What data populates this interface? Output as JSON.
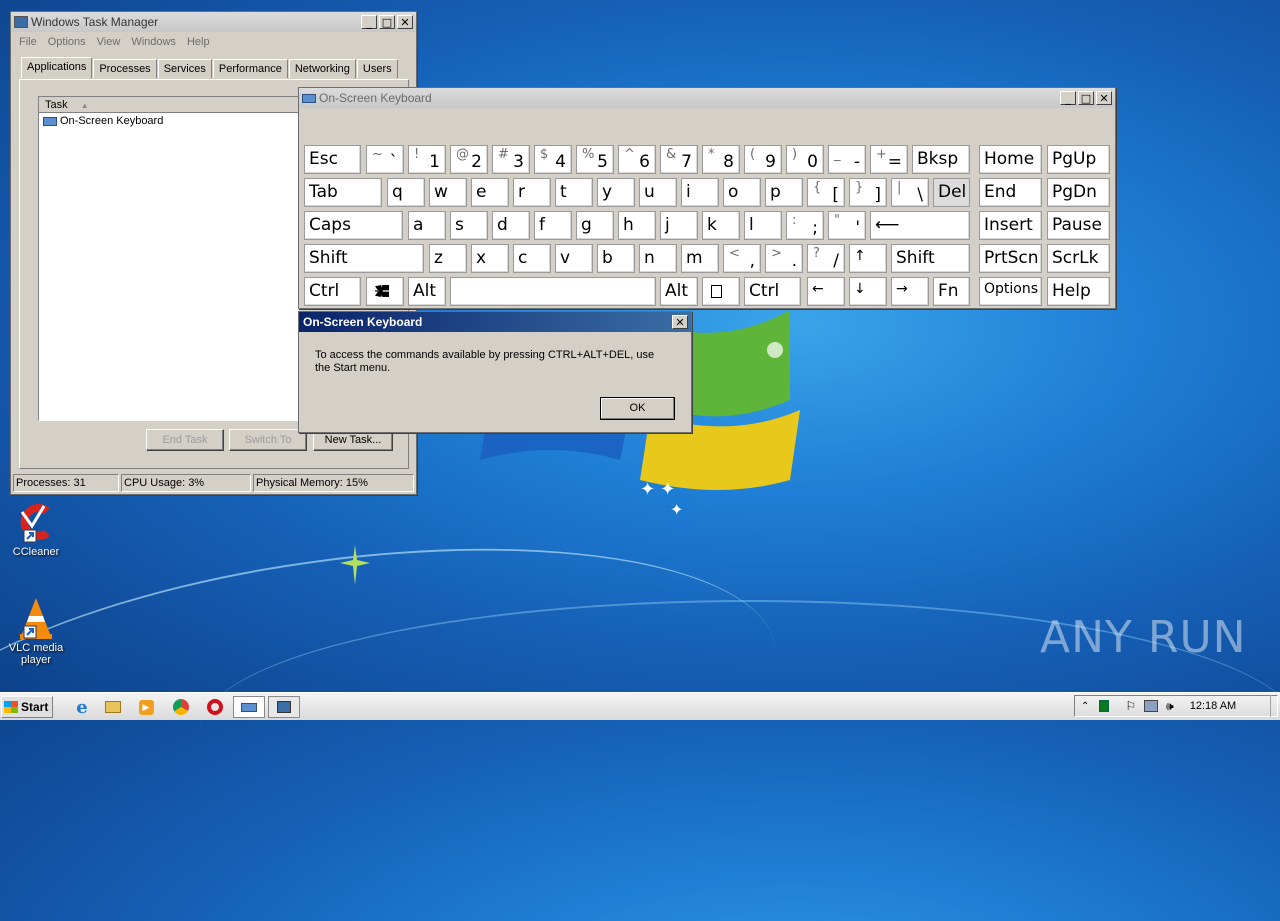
{
  "taskmgr": {
    "title": "Windows Task Manager",
    "menu": [
      "File",
      "Options",
      "View",
      "Windows",
      "Help"
    ],
    "tabs": [
      "Applications",
      "Processes",
      "Services",
      "Performance",
      "Networking",
      "Users"
    ],
    "list_header": "Task",
    "tasks": [
      "On-Screen Keyboard"
    ],
    "buttons": {
      "end_task": "End Task",
      "switch_to": "Switch To",
      "new_task": "New Task..."
    },
    "status": {
      "processes": "Processes: 31",
      "cpu": "CPU Usage: 3%",
      "memory": "Physical Memory: 15%"
    }
  },
  "osk": {
    "title": "On-Screen Keyboard",
    "keys": {
      "esc": "Esc",
      "bksp": "Bksp",
      "tab": "Tab",
      "del": "Del",
      "caps": "Caps",
      "shift": "Shift",
      "ctrl": "Ctrl",
      "alt": "Alt",
      "home": "Home",
      "pgup": "PgUp",
      "end": "End",
      "pgdn": "PgDn",
      "insert": "Insert",
      "pause": "Pause",
      "prtscn": "PrtScn",
      "scrlk": "ScrLk",
      "fn": "Fn",
      "options": "Options",
      "help": "Help"
    },
    "row1": [
      [
        "~",
        "`"
      ],
      [
        "!",
        "1"
      ],
      [
        "@",
        "2"
      ],
      [
        "#",
        "3"
      ],
      [
        "$",
        "4"
      ],
      [
        "%",
        "5"
      ],
      [
        "^",
        "6"
      ],
      [
        "&",
        "7"
      ],
      [
        "*",
        "8"
      ],
      [
        "(",
        "9"
      ],
      [
        ")",
        "0"
      ],
      [
        "_",
        "-"
      ],
      [
        "+",
        "="
      ]
    ],
    "row2": [
      "q",
      "w",
      "e",
      "r",
      "t",
      "y",
      "u",
      "i",
      "o",
      "p"
    ],
    "row2_sym": [
      [
        "{",
        "["
      ],
      [
        "}",
        "]"
      ],
      [
        "|",
        "\\"
      ]
    ],
    "row3": [
      "a",
      "s",
      "d",
      "f",
      "g",
      "h",
      "j",
      "k",
      "l"
    ],
    "row3_sym": [
      [
        ":",
        ";"
      ],
      [
        "\"",
        "'"
      ]
    ],
    "row4": [
      "z",
      "x",
      "c",
      "v",
      "b",
      "n",
      "m"
    ],
    "row4_sym": [
      [
        "<",
        ","
      ],
      [
        ">",
        "."
      ],
      [
        "?",
        "/"
      ]
    ],
    "arrows": {
      "up": "↑",
      "left": "←",
      "down": "↓",
      "right": "→"
    },
    "enter": "⟵"
  },
  "dialog": {
    "title": "On-Screen Keyboard",
    "message": "To access the commands available by pressing CTRL+ALT+DEL, use the Start menu.",
    "ok": "OK"
  },
  "desktop": {
    "icons": [
      {
        "label": "CCleaner"
      },
      {
        "label": "VLC media player"
      }
    ],
    "watermark": "ANY RUN"
  },
  "taskbar": {
    "start": "Start",
    "clock": "12:18 AM"
  }
}
